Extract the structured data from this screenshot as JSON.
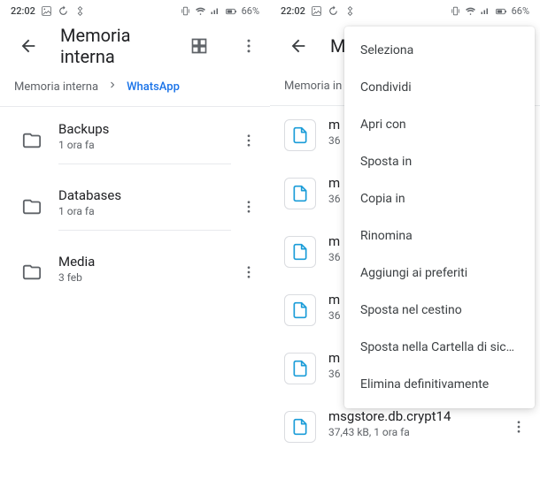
{
  "status": {
    "time": "22:02",
    "battery": "66%"
  },
  "left": {
    "title": "Memoria interna",
    "breadcrumb": {
      "root": "Memoria interna",
      "current": "WhatsApp"
    },
    "items": [
      {
        "type": "folder",
        "name": "Backups",
        "meta": "1 ora fa"
      },
      {
        "type": "folder",
        "name": "Databases",
        "meta": "1 ora fa"
      },
      {
        "type": "folder",
        "name": "Media",
        "meta": "3 feb"
      }
    ]
  },
  "right": {
    "title_visible": "Me",
    "breadcrumb_visible": "Memoria in",
    "items": [
      {
        "name_visible": "m",
        "meta_visible": "36"
      },
      {
        "name_visible": "m",
        "meta_visible": "36"
      },
      {
        "name_visible": "m",
        "meta_visible": "36"
      },
      {
        "name_visible": "m",
        "meta_visible": "36"
      },
      {
        "name_visible": "m",
        "meta_visible": "36"
      },
      {
        "name": "msgstore.db.crypt14",
        "meta": "37,43 kB, 1 ora fa"
      }
    ],
    "menu": [
      "Seleziona",
      "Condividi",
      "Apri con",
      "Sposta in",
      "Copia in",
      "Rinomina",
      "Aggiungi ai preferiti",
      "Sposta nel cestino",
      "Sposta nella Cartella di sicurezza",
      "Elimina definitivamente"
    ]
  }
}
